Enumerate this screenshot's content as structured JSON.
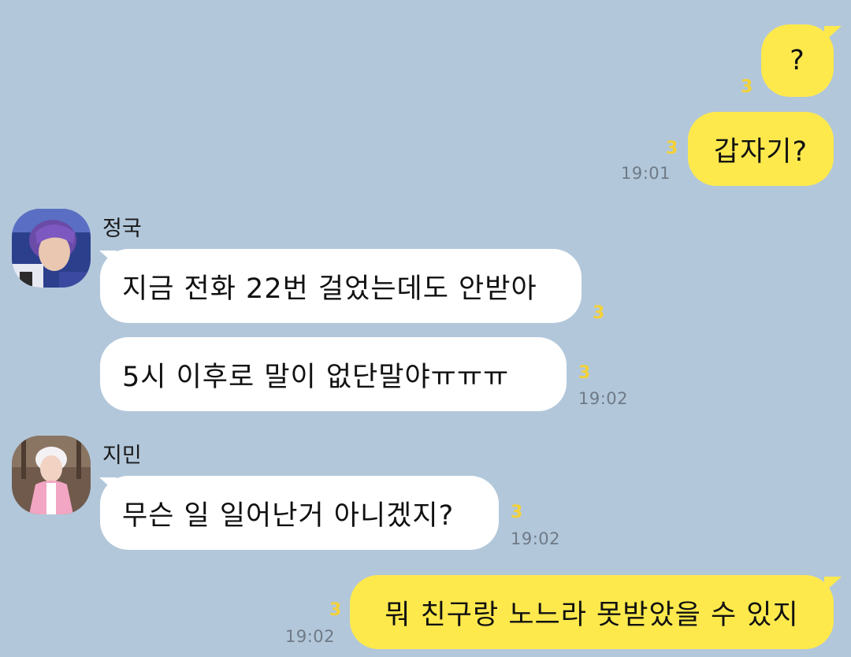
{
  "colors": {
    "background": "#b2c7da",
    "my_bubble": "#fee94d",
    "their_bubble": "#ffffff",
    "unread_count": "#f4d238",
    "timestamp": "#6f7a87"
  },
  "messages": [
    {
      "side": "right",
      "text": "?",
      "unread": "3",
      "time": ""
    },
    {
      "side": "right",
      "text": "갑자기?",
      "unread": "3",
      "time": "19:01"
    },
    {
      "side": "left",
      "sender": "정국",
      "avatar": "profile-photo-jungkook",
      "text": "지금 전화 22번 걸었는데도 안받아",
      "unread": "3",
      "time": ""
    },
    {
      "side": "left",
      "text": "5시 이후로 말이 없단말야ㅠㅠㅠ",
      "unread": "3",
      "time": "19:02"
    },
    {
      "side": "left",
      "sender": "지민",
      "avatar": "profile-photo-jimin",
      "text": "무슨 일 일어난거 아니겠지?",
      "unread": "3",
      "time": "19:02"
    },
    {
      "side": "right",
      "text": "뭐 친구랑 노느라 못받았을 수 있지",
      "unread": "3",
      "time": "19:02"
    }
  ]
}
